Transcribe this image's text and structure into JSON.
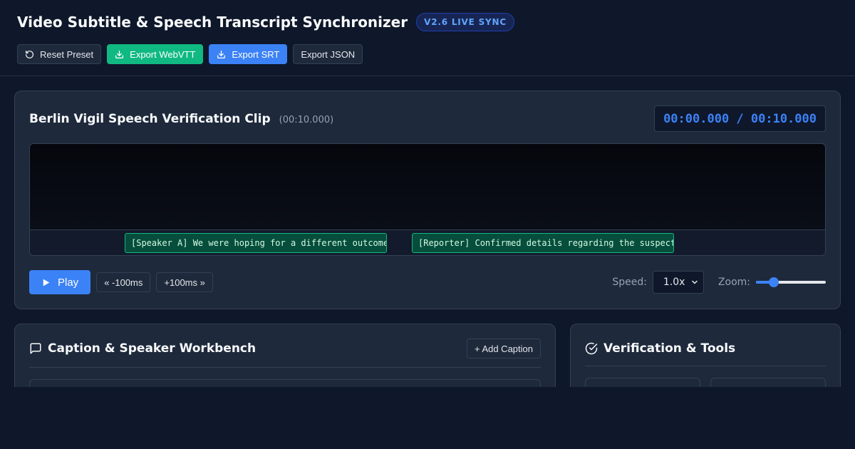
{
  "header": {
    "title": "Video Subtitle & Speech Transcript Synchronizer",
    "badge": "V2.6 LIVE SYNC",
    "buttons": {
      "reset": "Reset Preset",
      "export_webvtt": "Export WebVTT",
      "export_srt": "Export SRT",
      "export_json": "Export JSON"
    }
  },
  "player": {
    "clip_title": "Berlin Vigil Speech Verification Clip",
    "clip_duration": "(00:10.000)",
    "timecode": "00:00.000 / 00:10.000",
    "cues": [
      {
        "text": "[Speaker A] We were hoping for a different outcome",
        "start": 1.2,
        "end": 4.5
      },
      {
        "text": "[Reporter] Confirmed details regarding the suspect",
        "start": 4.8,
        "end": 8.1
      }
    ],
    "play_label": "Play",
    "nudge_back": "« -100ms",
    "nudge_forward": "+100ms »",
    "speed_label": "Speed:",
    "speed_value": "1.0x",
    "zoom_label": "Zoom:",
    "zoom_fraction": 0.25
  },
  "workbench": {
    "title": "Caption & Speaker Workbench",
    "add_caption": "+ Add Caption"
  },
  "tools": {
    "title": "Verification & Tools"
  },
  "colors": {
    "accent_blue": "#3b82f6",
    "accent_green": "#10b981",
    "background": "#0f172a",
    "card": "#1e293b"
  },
  "icons": [
    "reset-icon",
    "download-icon",
    "play-icon",
    "chevron-down-icon",
    "comment-icon",
    "check-circle-icon"
  ]
}
